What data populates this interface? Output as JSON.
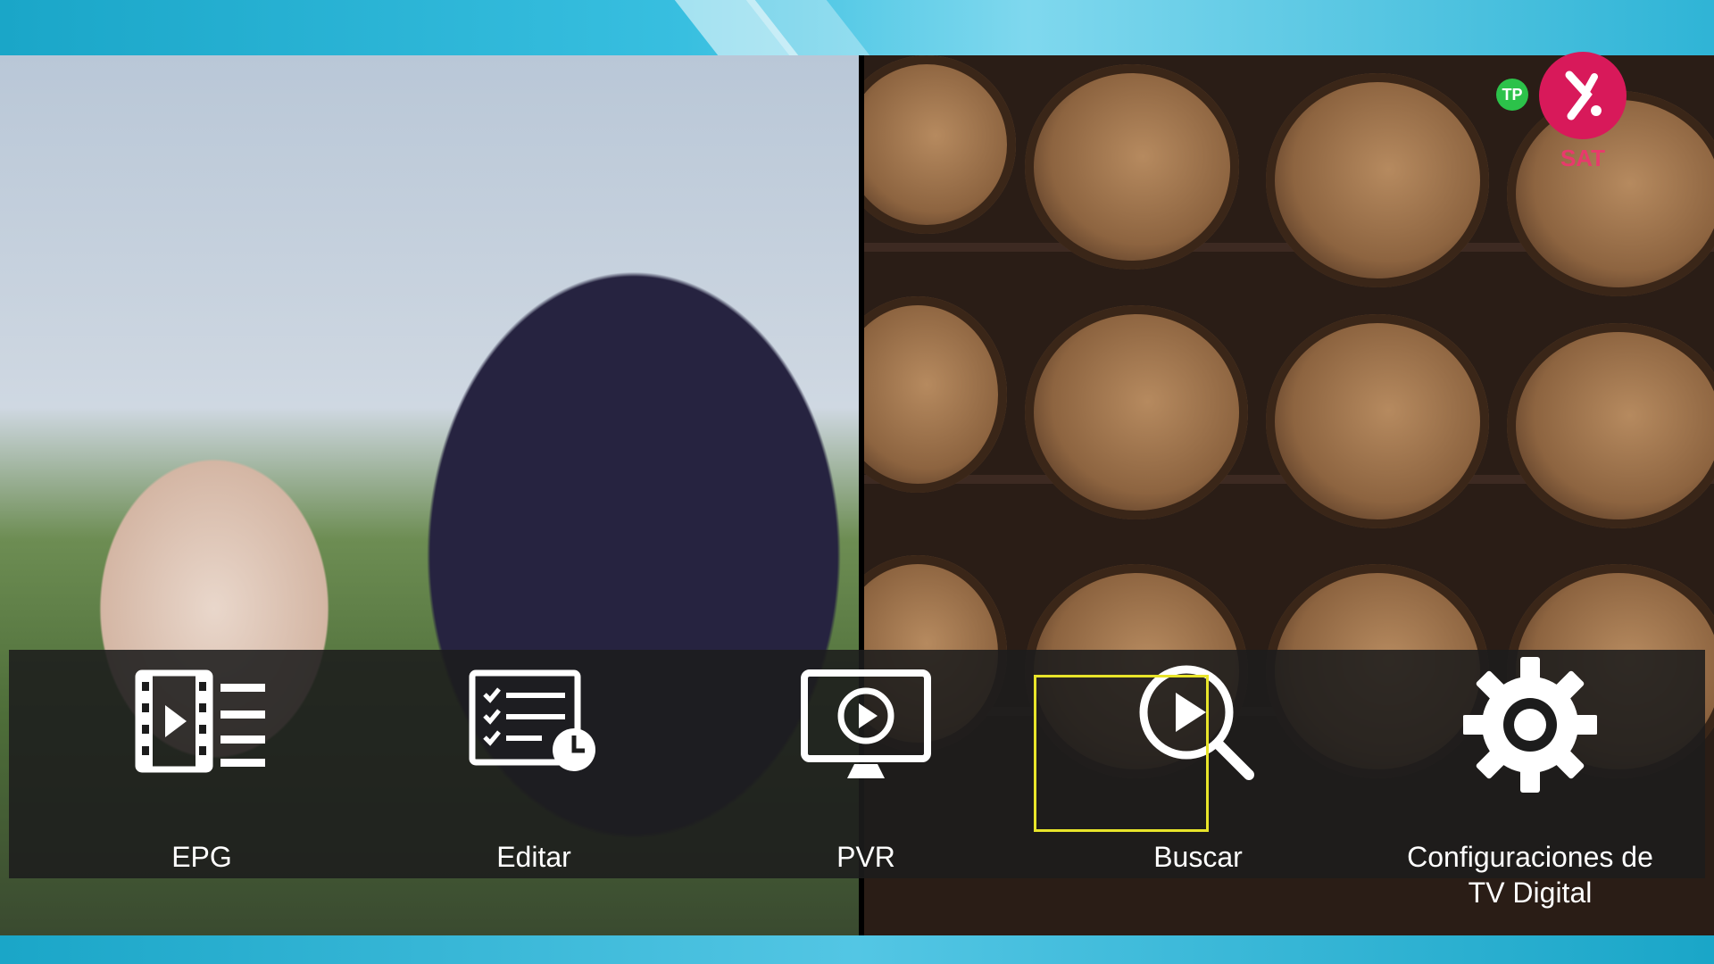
{
  "overlay_logo": {
    "badge_text": "TP",
    "channel_label": "SAT",
    "accent_color": "#d8195a",
    "badge_color": "#2cc24a"
  },
  "menu": {
    "selected_index": 3,
    "selection_color": "#e8e42a",
    "items": [
      {
        "label": "EPG",
        "icon": "film-list-icon"
      },
      {
        "label": "Editar",
        "icon": "schedule-checklist-icon"
      },
      {
        "label": "PVR",
        "icon": "monitor-play-icon"
      },
      {
        "label": "Buscar",
        "icon": "play-search-icon"
      },
      {
        "label_line1": "Configuraciones de",
        "label_line2": "TV Digital",
        "icon": "gear-icon"
      }
    ]
  }
}
